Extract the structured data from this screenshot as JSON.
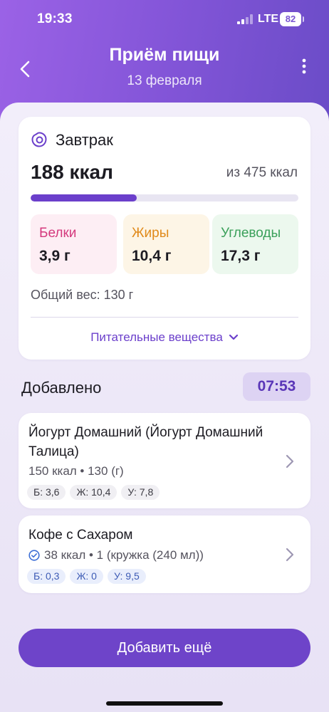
{
  "status_bar": {
    "time": "19:33",
    "network": "LTE",
    "battery": "82"
  },
  "header": {
    "title": "Приём пищи",
    "date": "13 февраля"
  },
  "summary": {
    "meal_name": "Завтрак",
    "kcal": "188 ккал",
    "kcal_total": "из 475 ккал",
    "progress_fraction": 0.396,
    "macros": {
      "protein": {
        "label": "Белки",
        "value": "3,9 г"
      },
      "fat": {
        "label": "Жиры",
        "value": "10,4 г"
      },
      "carbs": {
        "label": "Углеводы",
        "value": "17,3 г"
      }
    },
    "weight": "Общий вес: 130 г",
    "nutrients_link": "Питательные вещества"
  },
  "added": {
    "title": "Добавлено",
    "time": "07:53",
    "items": [
      {
        "name": "Йогурт Домашний (Йогурт Домашний Талица)",
        "meta": "150 ккал • 130 (г)",
        "verified": false,
        "chips": [
          "Б: 3,6",
          "Ж: 10,4",
          "У: 7,8"
        ]
      },
      {
        "name": "Кофе с Сахаром",
        "meta": "38 ккал • 1 (кружка (240 мл))",
        "verified": true,
        "chips": [
          "Б: 0,3",
          "Ж: 0",
          "У: 9,5"
        ]
      }
    ]
  },
  "add_more_label": "Добавить ещё",
  "colors": {
    "accent": "#6e44c9",
    "protein": "#d4397d",
    "fat": "#e08a1a",
    "carbs": "#3aa05a"
  }
}
